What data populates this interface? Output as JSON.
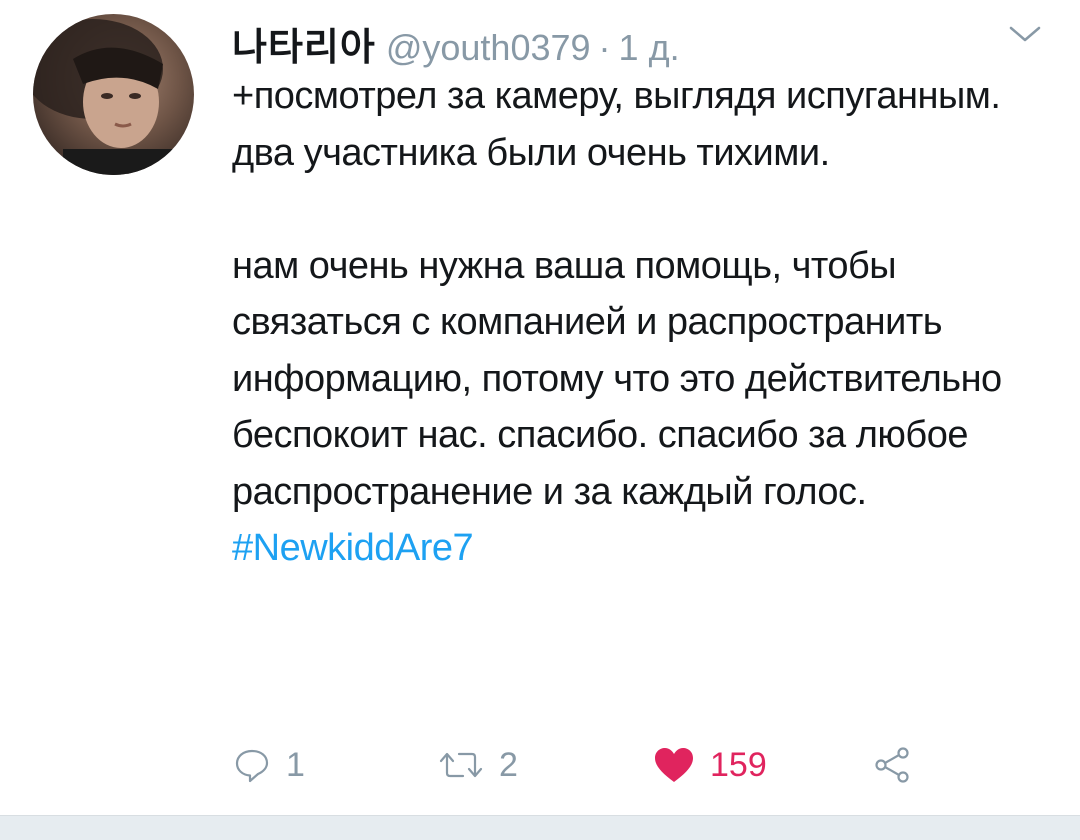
{
  "tweet": {
    "display_name": "나타리아",
    "handle": "@youth0379",
    "separator": "·",
    "time": "1 д.",
    "paragraph1": "+посмотрел за камеру, выглядя испуганным. два участника были очень тихими.",
    "paragraph2": "нам очень нужна ваша помощь, чтобы связаться с компанией и распространить информацию, потому что это действительно беспокоит нас. спасибо. спасибо за любое распространение и за каждый голос.",
    "hashtag": "#NewkiddAre7"
  },
  "actions": {
    "reply_count": "1",
    "retweet_count": "2",
    "like_count": "159"
  },
  "colors": {
    "text": "#14171a",
    "muted": "#8899a6",
    "link": "#1da1f2",
    "like": "#e0245e"
  },
  "icons": [
    "chevron-down-icon",
    "reply-icon",
    "retweet-icon",
    "heart-icon",
    "share-icon"
  ]
}
